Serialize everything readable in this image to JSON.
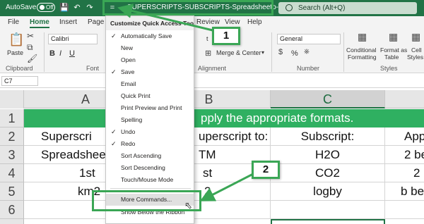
{
  "titlebar": {
    "autosave_label": "AutoSave",
    "autosave_state": "Off",
    "qat_button": "=",
    "filename": "SUPERSCRIPTS-SUBSCRIPTS-Spreadsheeto-Project-File",
    "filename_caret": "▾",
    "search_placeholder": "Search (Alt+Q)",
    "accent_color": "#217346"
  },
  "ribbon": {
    "tabs": [
      "File",
      "Home",
      "Insert",
      "Page",
      "Review",
      "View",
      "Help"
    ],
    "active_tab": "Home",
    "font_name": "Calibri",
    "number_format": "General",
    "merge_center": "Merge & Center",
    "paste": "Paste",
    "conditional_formatting_1": "Conditional",
    "conditional_formatting_2": "Formatting",
    "format_as_table_1": "Format as",
    "format_as_table_2": "Table",
    "cell_styles_1": "Cell",
    "cell_styles_2": "Styles",
    "bold": "B",
    "italic": "I",
    "underline": "U",
    "groups": {
      "clipboard": "Clipboard",
      "font": "Font",
      "alignment": "Alignment",
      "number": "Number",
      "styles": "Styles"
    },
    "wrap_fragment": "t",
    "percent": "%"
  },
  "formula_bar": {
    "name_box": "C7"
  },
  "grid": {
    "columns": [
      "A",
      "B",
      "C"
    ],
    "rows": [
      "1",
      "2",
      "3",
      "4",
      "5",
      "6"
    ],
    "banner": "pply the appropriate formats.",
    "row2": [
      "Superscri",
      "uperscript to:",
      "Subscript:",
      "App"
    ],
    "row3": [
      "Spreadsheet",
      "TM",
      "H2O",
      "2 be"
    ],
    "row4": [
      "1st",
      "st",
      "CO2",
      "2"
    ],
    "row5": [
      "km2",
      "2",
      "logby",
      "b be"
    ]
  },
  "menu": {
    "title": "Customize Quick Access Toolbar",
    "items": [
      {
        "label": "Automatically Save",
        "checked": true
      },
      {
        "label": "New",
        "checked": false
      },
      {
        "label": "Open",
        "checked": false
      },
      {
        "label": "Save",
        "checked": true
      },
      {
        "label": "Email",
        "checked": false
      },
      {
        "label": "Quick Print",
        "checked": false
      },
      {
        "label": "Print Preview and Print",
        "checked": false
      },
      {
        "label": "Spelling",
        "checked": false
      },
      {
        "label": "Undo",
        "checked": true
      },
      {
        "label": "Redo",
        "checked": true
      },
      {
        "label": "Sort Ascending",
        "checked": false
      },
      {
        "label": "Sort Descending",
        "checked": false
      },
      {
        "label": "Touch/Mouse Mode",
        "checked": false
      }
    ],
    "more_commands": "More Commands...",
    "show_below": "Show Below the Ribbon",
    "check_glyph": "✓"
  },
  "callouts": {
    "badge_1": "1",
    "badge_2": "2",
    "color": "#3aa655"
  }
}
